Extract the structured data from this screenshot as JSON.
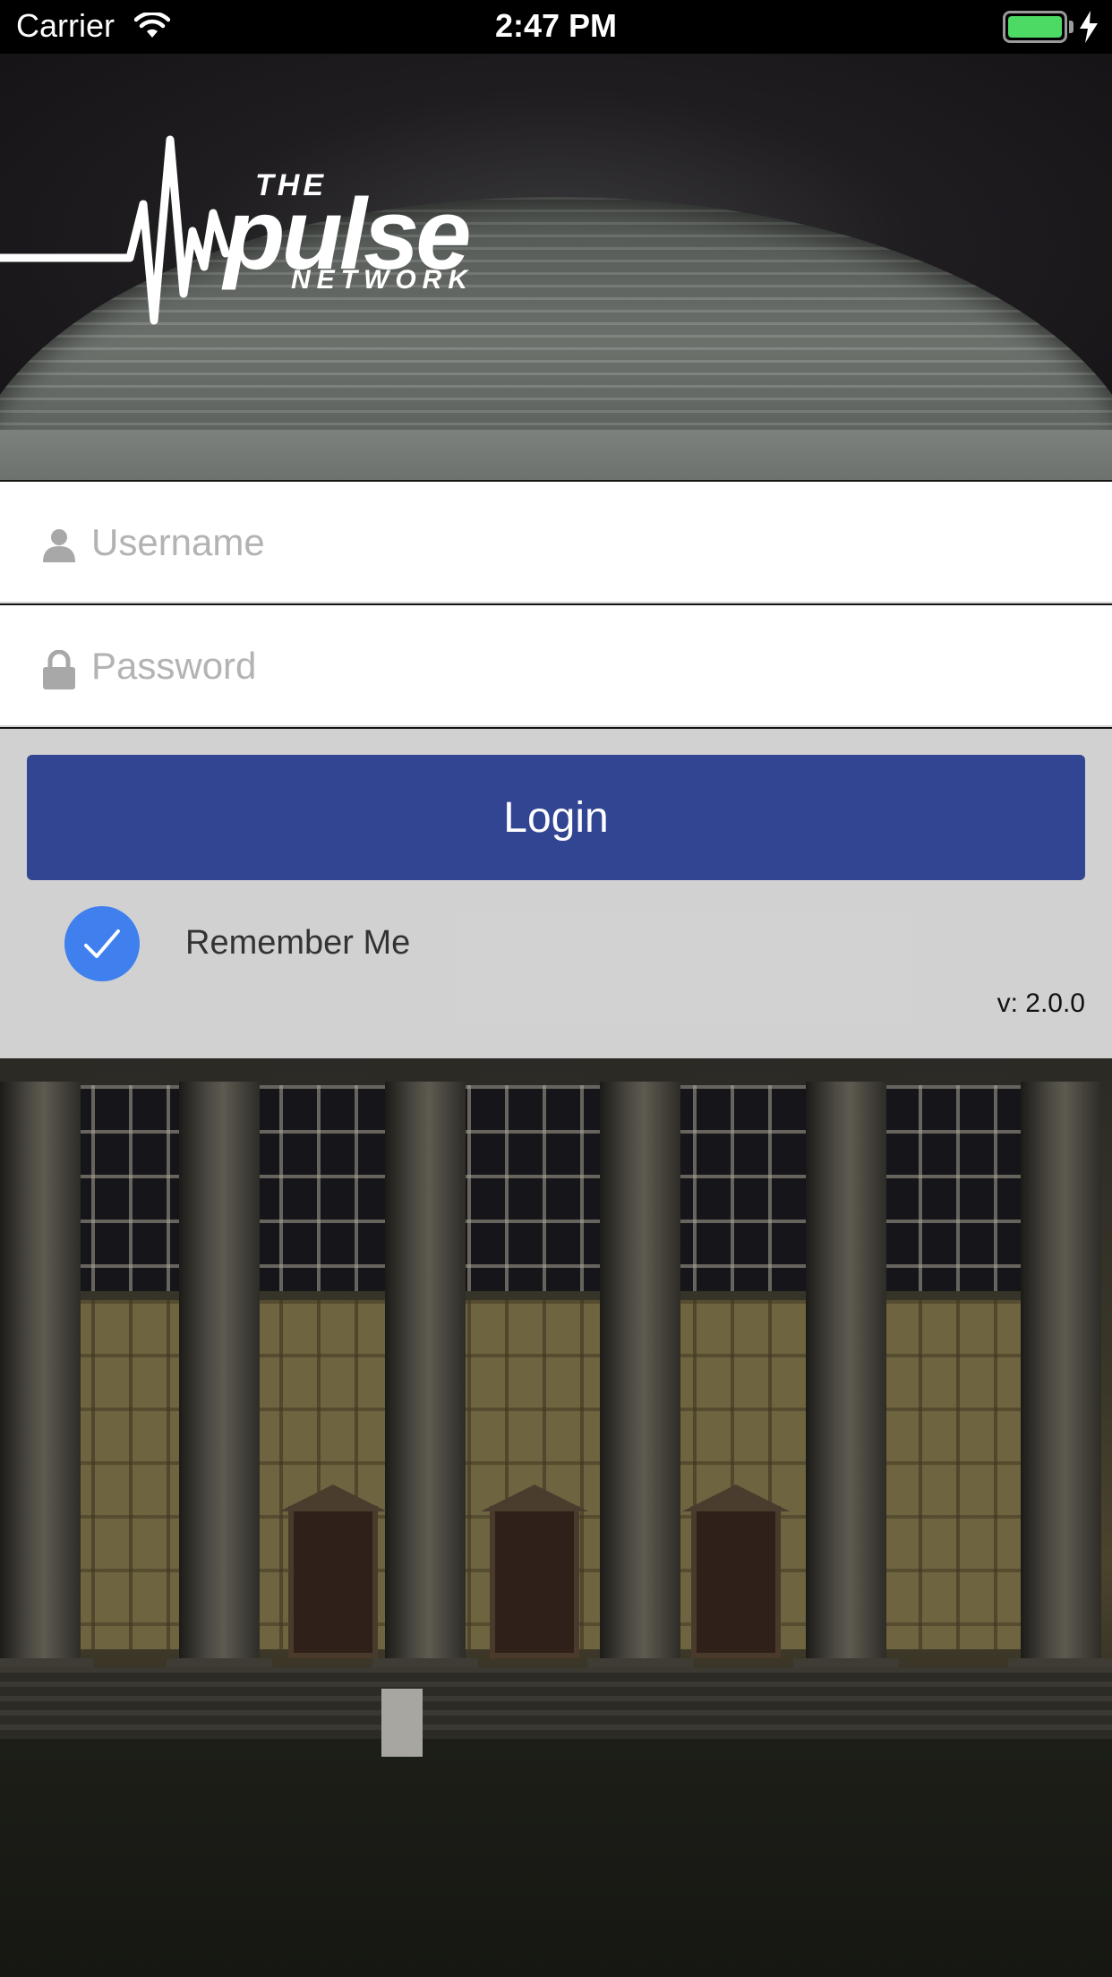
{
  "status_bar": {
    "carrier": "Carrier",
    "time": "2:47 PM",
    "battery_level": 1.0,
    "charging": true,
    "icons": [
      "wifi-icon",
      "battery-icon",
      "charging-bolt-icon"
    ]
  },
  "header": {
    "logo": {
      "the": "THE",
      "pulse": "pulse",
      "network": "NETWORK"
    }
  },
  "form": {
    "username": {
      "value": "",
      "placeholder": "Username",
      "icon": "person-icon"
    },
    "password": {
      "value": "",
      "placeholder": "Password",
      "icon": "lock-icon"
    },
    "login_label": "Login",
    "remember_me": {
      "label": "Remember Me",
      "checked": true
    }
  },
  "version": "v: 2.0.0",
  "colors": {
    "login_button": "#324592",
    "checkbox": "#3f80ee",
    "placeholder": "#b3b3b3",
    "battery": "#4cd964"
  }
}
